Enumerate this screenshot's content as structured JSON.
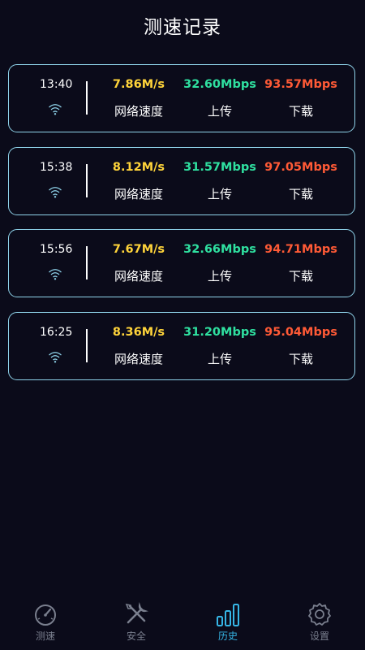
{
  "header": {
    "title": "测速记录"
  },
  "colors": {
    "network": "#ffd43a",
    "upload": "#2fe0a0",
    "download": "#ff5a36",
    "card_border": "#8fd3ea",
    "tab_active": "#36b6e6",
    "tab_inactive": "#7a7f8e"
  },
  "records": [
    {
      "time": "13:40",
      "network_speed": "7.86M/s",
      "upload": "32.60Mbps",
      "download": "93.57Mbps",
      "network_label": "网络速度",
      "upload_label": "上传",
      "download_label": "下载"
    },
    {
      "time": "15:38",
      "network_speed": "8.12M/s",
      "upload": "31.57Mbps",
      "download": "97.05Mbps",
      "network_label": "网络速度",
      "upload_label": "上传",
      "download_label": "下载"
    },
    {
      "time": "15:56",
      "network_speed": "7.67M/s",
      "upload": "32.66Mbps",
      "download": "94.71Mbps",
      "network_label": "网络速度",
      "upload_label": "上传",
      "download_label": "下载"
    },
    {
      "time": "16:25",
      "network_speed": "8.36M/s",
      "upload": "31.20Mbps",
      "download": "95.04Mbps",
      "network_label": "网络速度",
      "upload_label": "上传",
      "download_label": "下载"
    }
  ],
  "tabs": [
    {
      "label": "测速",
      "icon": "speedometer-icon",
      "active": false
    },
    {
      "label": "安全",
      "icon": "tools-icon",
      "active": false
    },
    {
      "label": "历史",
      "icon": "bar-chart-icon",
      "active": true
    },
    {
      "label": "设置",
      "icon": "gear-icon",
      "active": false
    }
  ]
}
